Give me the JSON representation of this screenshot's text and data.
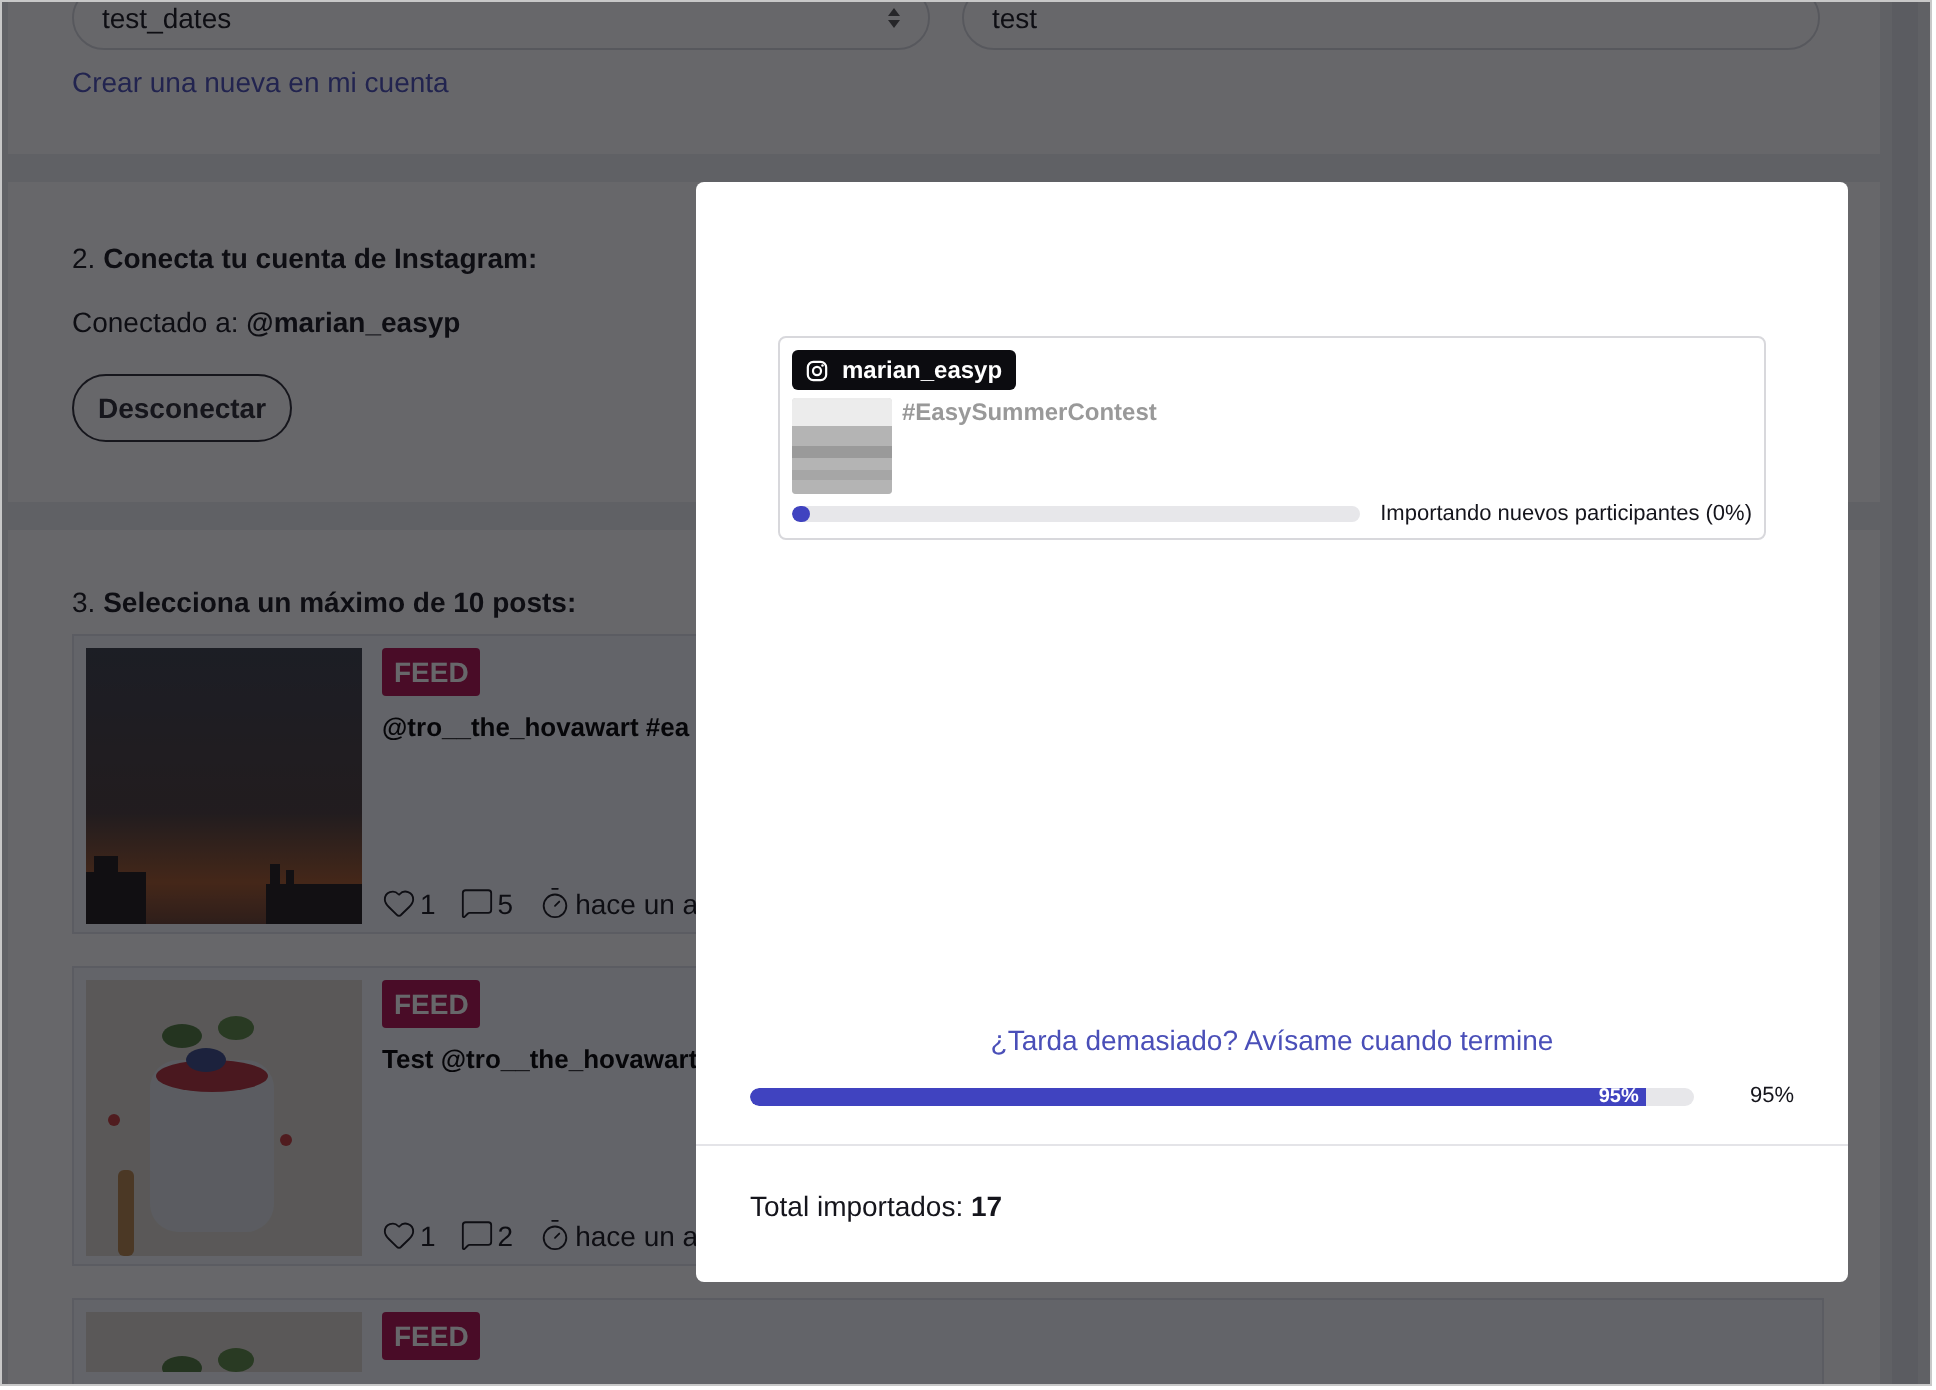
{
  "form": {
    "list_select": "test_dates",
    "name_field": "test",
    "create_link": "Crear una nueva en mi cuenta"
  },
  "instagram": {
    "heading": "2. **Conecta tu cuenta de Instagram:**",
    "connected": "Conectado a: **@marian_easyp**",
    "disconnect_button": "Desconectar"
  },
  "posts_section": {
    "heading": "3. **Selecciona un máximo de 10 posts:**",
    "posts": [
      {
        "kind": "sunset",
        "badge": "FEED",
        "caption": "@tro__the_hovawart #ea",
        "likes": "1",
        "comments": "5",
        "time": "hace un a"
      },
      {
        "kind": "food",
        "badge": "FEED",
        "caption": "Test @tro__the_hovawart",
        "likes": "1",
        "comments": "2",
        "time": "hace un a"
      },
      {
        "kind": "food",
        "badge": "FEED"
      }
    ]
  },
  "modal": {
    "import_item": {
      "account": "marian_easyp",
      "hashtag": "#EasySummerContest",
      "level": 0.03,
      "status": "Importando nuevos participantes (0%)"
    },
    "notify_link": "¿Tarda demasiado? Avísame cuando termine",
    "progress": {
      "level": 0.95,
      "bar_label": "95%",
      "reading": "95%"
    },
    "total": "Total importados: **17**"
  }
}
